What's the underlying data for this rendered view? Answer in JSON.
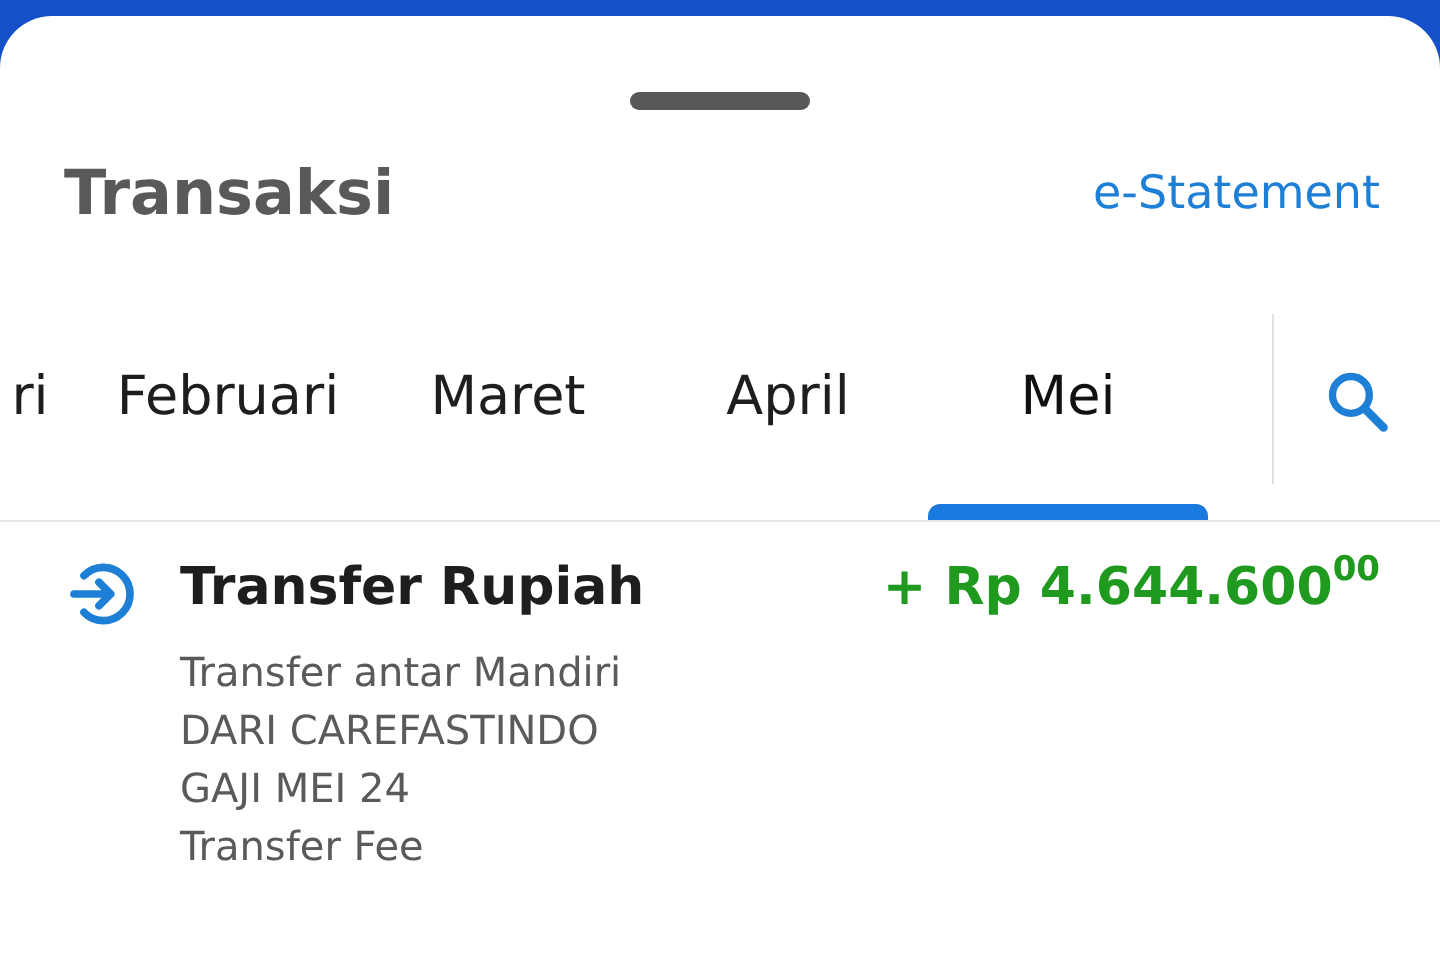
{
  "header": {
    "title": "Transaksi",
    "link": "e-Statement"
  },
  "tabs": [
    {
      "label": "ri",
      "selected": false
    },
    {
      "label": "Februari",
      "selected": false
    },
    {
      "label": "Maret",
      "selected": false
    },
    {
      "label": "April",
      "selected": false
    },
    {
      "label": "Mei",
      "selected": true
    }
  ],
  "transactions": [
    {
      "title": "Transfer Rupiah",
      "amount": "+ Rp 4.644.600$^{00}$",
      "details": [
        "Transfer antar Mandiri",
        "DARI CAREFASTINDO",
        "GAJI MEI 24",
        "Transfer Fee"
      ]
    }
  ]
}
